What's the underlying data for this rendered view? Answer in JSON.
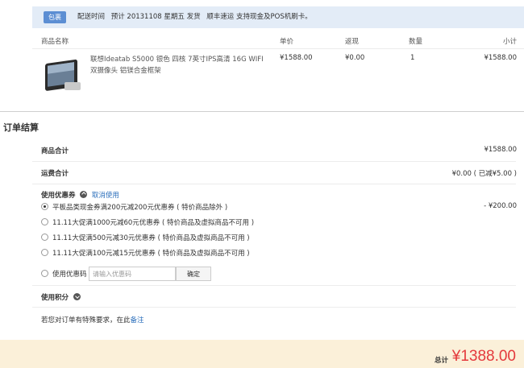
{
  "package": {
    "tag": "包裹",
    "delivery_time_label": "配送时间",
    "delivery_estimate": "预计 20131108 星期五 发货",
    "delivery_note": "顺丰速运 支持现金及POS机刷卡。"
  },
  "table": {
    "headers": {
      "product": "商品名称",
      "price": "单价",
      "rebate": "返现",
      "quantity": "数量",
      "subtotal": "小计"
    },
    "rows": [
      {
        "name": "联想Ideatab S5000 银色 四核 7英寸IPS高清 16G WIFI 双摄像头 铝镁合金框架",
        "price": "¥1588.00",
        "rebate": "¥0.00",
        "quantity": "1",
        "subtotal": "¥1588.00"
      }
    ]
  },
  "settlement": {
    "title": "订单结算",
    "goods_total_label": "商品合计",
    "goods_total_value": "¥1588.00",
    "shipping_label": "运费合计",
    "shipping_value": "¥0.00 ( 已减¥5.00 )"
  },
  "coupons": {
    "title": "使用优惠券",
    "cancel_label": "取消使用",
    "options": [
      {
        "label": "平板品类现金券满200元减200元优惠券 ( 特价商品除外 )",
        "value": "- ¥200.00",
        "checked": true
      },
      {
        "label": "11.11大促满1000元减60元优惠券 ( 特价商品及虚拟商品不可用 )",
        "value": "",
        "checked": false
      },
      {
        "label": "11.11大促满500元减30元优惠券 ( 特价商品及虚拟商品不可用 )",
        "value": "",
        "checked": false
      },
      {
        "label": "11.11大促满100元减15元优惠券 ( 特价商品及虚拟商品不可用 )",
        "value": "",
        "checked": false
      }
    ],
    "code_label": "使用优惠码",
    "code_placeholder": "请输入优惠码",
    "confirm_label": "确定"
  },
  "points": {
    "label": "使用积分"
  },
  "remark": {
    "text": "若您对订单有特殊要求，在此",
    "link": "备注"
  },
  "total": {
    "label": "总计",
    "value": "¥1388.00"
  },
  "colors": {
    "accent": "#e4393c",
    "link": "#2a6ebb",
    "tag": "#5c8ed3",
    "footer_bg": "#fbf0d9"
  }
}
